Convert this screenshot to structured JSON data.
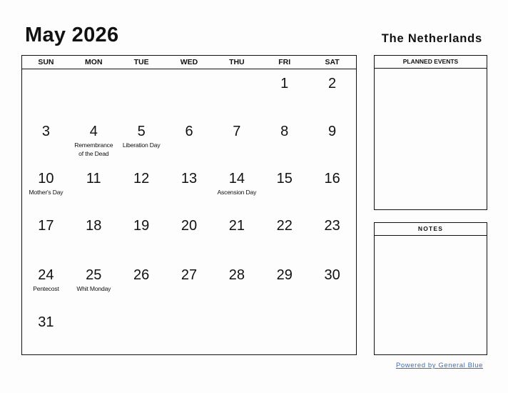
{
  "header": {
    "title": "May 2026",
    "country": "The Netherlands"
  },
  "calendar": {
    "weekdays": [
      "SUN",
      "MON",
      "TUE",
      "WED",
      "THU",
      "FRI",
      "SAT"
    ],
    "weeks": [
      [
        {
          "day": ""
        },
        {
          "day": ""
        },
        {
          "day": ""
        },
        {
          "day": ""
        },
        {
          "day": ""
        },
        {
          "day": "1"
        },
        {
          "day": "2"
        }
      ],
      [
        {
          "day": "3"
        },
        {
          "day": "4",
          "holiday": "Remembrance of the Dead"
        },
        {
          "day": "5",
          "holiday": "Liberation Day"
        },
        {
          "day": "6"
        },
        {
          "day": "7"
        },
        {
          "day": "8"
        },
        {
          "day": "9"
        }
      ],
      [
        {
          "day": "10",
          "holiday": "Mother's Day"
        },
        {
          "day": "11"
        },
        {
          "day": "12"
        },
        {
          "day": "13"
        },
        {
          "day": "14",
          "holiday": "Ascension Day"
        },
        {
          "day": "15"
        },
        {
          "day": "16"
        }
      ],
      [
        {
          "day": "17"
        },
        {
          "day": "18"
        },
        {
          "day": "19"
        },
        {
          "day": "20"
        },
        {
          "day": "21"
        },
        {
          "day": "22"
        },
        {
          "day": "23"
        }
      ],
      [
        {
          "day": "24",
          "holiday": "Pentecost"
        },
        {
          "day": "25",
          "holiday": "Whit Monday"
        },
        {
          "day": "26"
        },
        {
          "day": "27"
        },
        {
          "day": "28"
        },
        {
          "day": "29"
        },
        {
          "day": "30"
        }
      ],
      [
        {
          "day": "31"
        },
        {
          "day": ""
        },
        {
          "day": ""
        },
        {
          "day": ""
        },
        {
          "day": ""
        },
        {
          "day": ""
        },
        {
          "day": ""
        }
      ]
    ]
  },
  "panels": {
    "planned_events": "PLANNED EVENTS",
    "notes": "NOTES"
  },
  "footer": {
    "powered_by": "Powered by General Blue",
    "link_color": "#3a6fb5"
  }
}
